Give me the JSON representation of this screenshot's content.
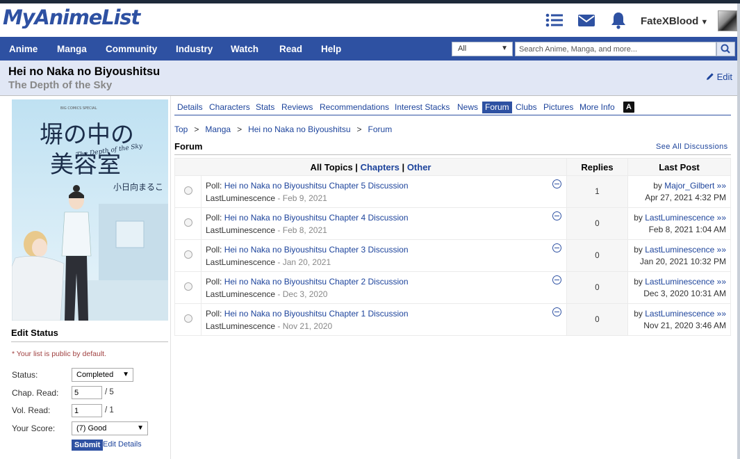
{
  "header": {
    "logo": "MyAnimeList",
    "username": "FateXBlood",
    "icons": [
      "list-icon",
      "mail-icon",
      "bell-icon"
    ]
  },
  "nav": {
    "items": [
      "Anime",
      "Manga",
      "Community",
      "Industry",
      "Watch",
      "Read",
      "Help"
    ],
    "search_type": "All",
    "search_placeholder": "Search Anime, Manga, and more..."
  },
  "title": {
    "main": "Hei no Naka no Biyoushitsu",
    "sub": "The Depth of the Sky",
    "edit_label": "Edit"
  },
  "cover": {
    "title_jp_line1": "塀の中の",
    "title_jp_line2": "美容室",
    "title_en": "The Depth of the Sky",
    "author": "小日向まるこ",
    "publisher_tag": "BIG COMICS SPECIAL"
  },
  "edit_status": {
    "heading": "Edit Status",
    "note": "* Your list is public by default.",
    "status_label": "Status:",
    "status_value": "Completed",
    "chap_label": "Chap. Read:",
    "chap_value": "5",
    "chap_total": "/ 5",
    "vol_label": "Vol. Read:",
    "vol_value": "1",
    "vol_total": "/ 1",
    "score_label": "Your Score:",
    "score_value": "(7) Good",
    "submit_label": "Submit",
    "edit_details_label": "Edit Details"
  },
  "tabs": {
    "items": [
      "Details",
      "Characters",
      "Stats",
      "Reviews",
      "Recommendations",
      "Interest Stacks",
      "News",
      "Forum",
      "Clubs",
      "Pictures",
      "More Info"
    ],
    "active": "Forum",
    "a_icon_text": "A"
  },
  "breadcrumb": {
    "items": [
      "Top",
      "Manga",
      "Hei no Naka no Biyoushitsu",
      "Forum"
    ],
    "separator": ">"
  },
  "forum": {
    "heading": "Forum",
    "see_all": "See All Discussions",
    "headers": {
      "all_topics": "All Topics",
      "sep": "|",
      "chapters": "Chapters",
      "other": "Other",
      "replies": "Replies",
      "last_post": "Last Post"
    },
    "topics": [
      {
        "prefix": "Poll:",
        "title": "Hei no Naka no Biyoushitsu Chapter 5 Discussion",
        "author": "LastLuminescence",
        "date": "- Feb 9, 2021",
        "replies": "1",
        "last_by": "by",
        "last_user": "Major_Gilbert",
        "raquo": "»»",
        "last_date": "Apr 27, 2021 4:32 PM"
      },
      {
        "prefix": "Poll:",
        "title": "Hei no Naka no Biyoushitsu Chapter 4 Discussion",
        "author": "LastLuminescence",
        "date": "- Feb 8, 2021",
        "replies": "0",
        "last_by": "by",
        "last_user": "LastLuminescence",
        "raquo": "»»",
        "last_date": "Feb 8, 2021 1:04 AM"
      },
      {
        "prefix": "Poll:",
        "title": "Hei no Naka no Biyoushitsu Chapter 3 Discussion",
        "author": "LastLuminescence",
        "date": "- Jan 20, 2021",
        "replies": "0",
        "last_by": "by",
        "last_user": "LastLuminescence",
        "raquo": "»»",
        "last_date": "Jan 20, 2021 10:32 PM"
      },
      {
        "prefix": "Poll:",
        "title": "Hei no Naka no Biyoushitsu Chapter 2 Discussion",
        "author": "LastLuminescence",
        "date": "- Dec 3, 2020",
        "replies": "0",
        "last_by": "by",
        "last_user": "LastLuminescence",
        "raquo": "»»",
        "last_date": "Dec 3, 2020 10:31 AM"
      },
      {
        "prefix": "Poll:",
        "title": "Hei no Naka no Biyoushitsu Chapter 1 Discussion",
        "author": "LastLuminescence",
        "date": "- Nov 21, 2020",
        "replies": "0",
        "last_by": "by",
        "last_user": "LastLuminescence",
        "raquo": "»»",
        "last_date": "Nov 21, 2020 3:46 AM"
      }
    ]
  },
  "colors": {
    "brand": "#2e51a2",
    "link": "#1c439b",
    "title_bar": "#e1e7f5"
  }
}
